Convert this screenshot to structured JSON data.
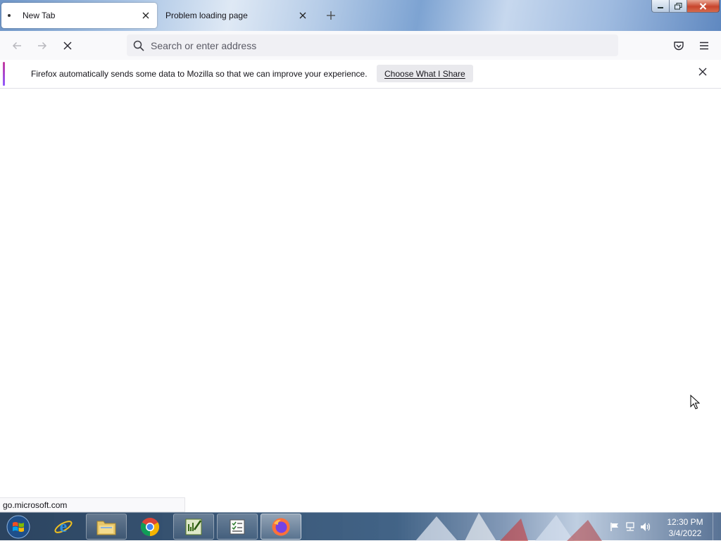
{
  "tabs": [
    {
      "title": "New Tab",
      "active": true,
      "close_icon": "close-icon"
    },
    {
      "title": "Problem loading page",
      "active": false,
      "close_icon": "close-icon"
    }
  ],
  "new_tab_icon": "plus-icon",
  "window_controls": {
    "minimize": "minimize-icon",
    "maximize": "restore-icon",
    "close": "close-icon"
  },
  "navbar": {
    "back_icon": "back-arrow-icon",
    "forward_icon": "forward-arrow-icon",
    "stop_icon": "stop-icon",
    "search_icon": "search-icon",
    "url_placeholder": "Search or enter address",
    "url_value": "",
    "pocket_icon": "pocket-icon",
    "menu_icon": "hamburger-menu-icon"
  },
  "notification": {
    "text": "Firefox automatically sends some data to Mozilla so that we can improve your experience.",
    "button_label": "Choose What I Share",
    "close_icon": "close-icon",
    "accent_colors": [
      "#c4389d",
      "#9059ff"
    ]
  },
  "status_bar": {
    "url": "go.microsoft.com"
  },
  "taskbar": {
    "start_icon": "windows-start-icon",
    "apps": [
      {
        "name": "internet-explorer-icon"
      },
      {
        "name": "file-explorer-icon"
      },
      {
        "name": "chrome-icon"
      },
      {
        "name": "spreadsheet-editor-icon"
      },
      {
        "name": "task-list-icon"
      },
      {
        "name": "firefox-icon"
      }
    ],
    "tray": [
      "action-center-flag-icon",
      "network-icon",
      "volume-icon"
    ],
    "clock": {
      "time": "12:30 PM",
      "date": "3/4/2022"
    }
  }
}
